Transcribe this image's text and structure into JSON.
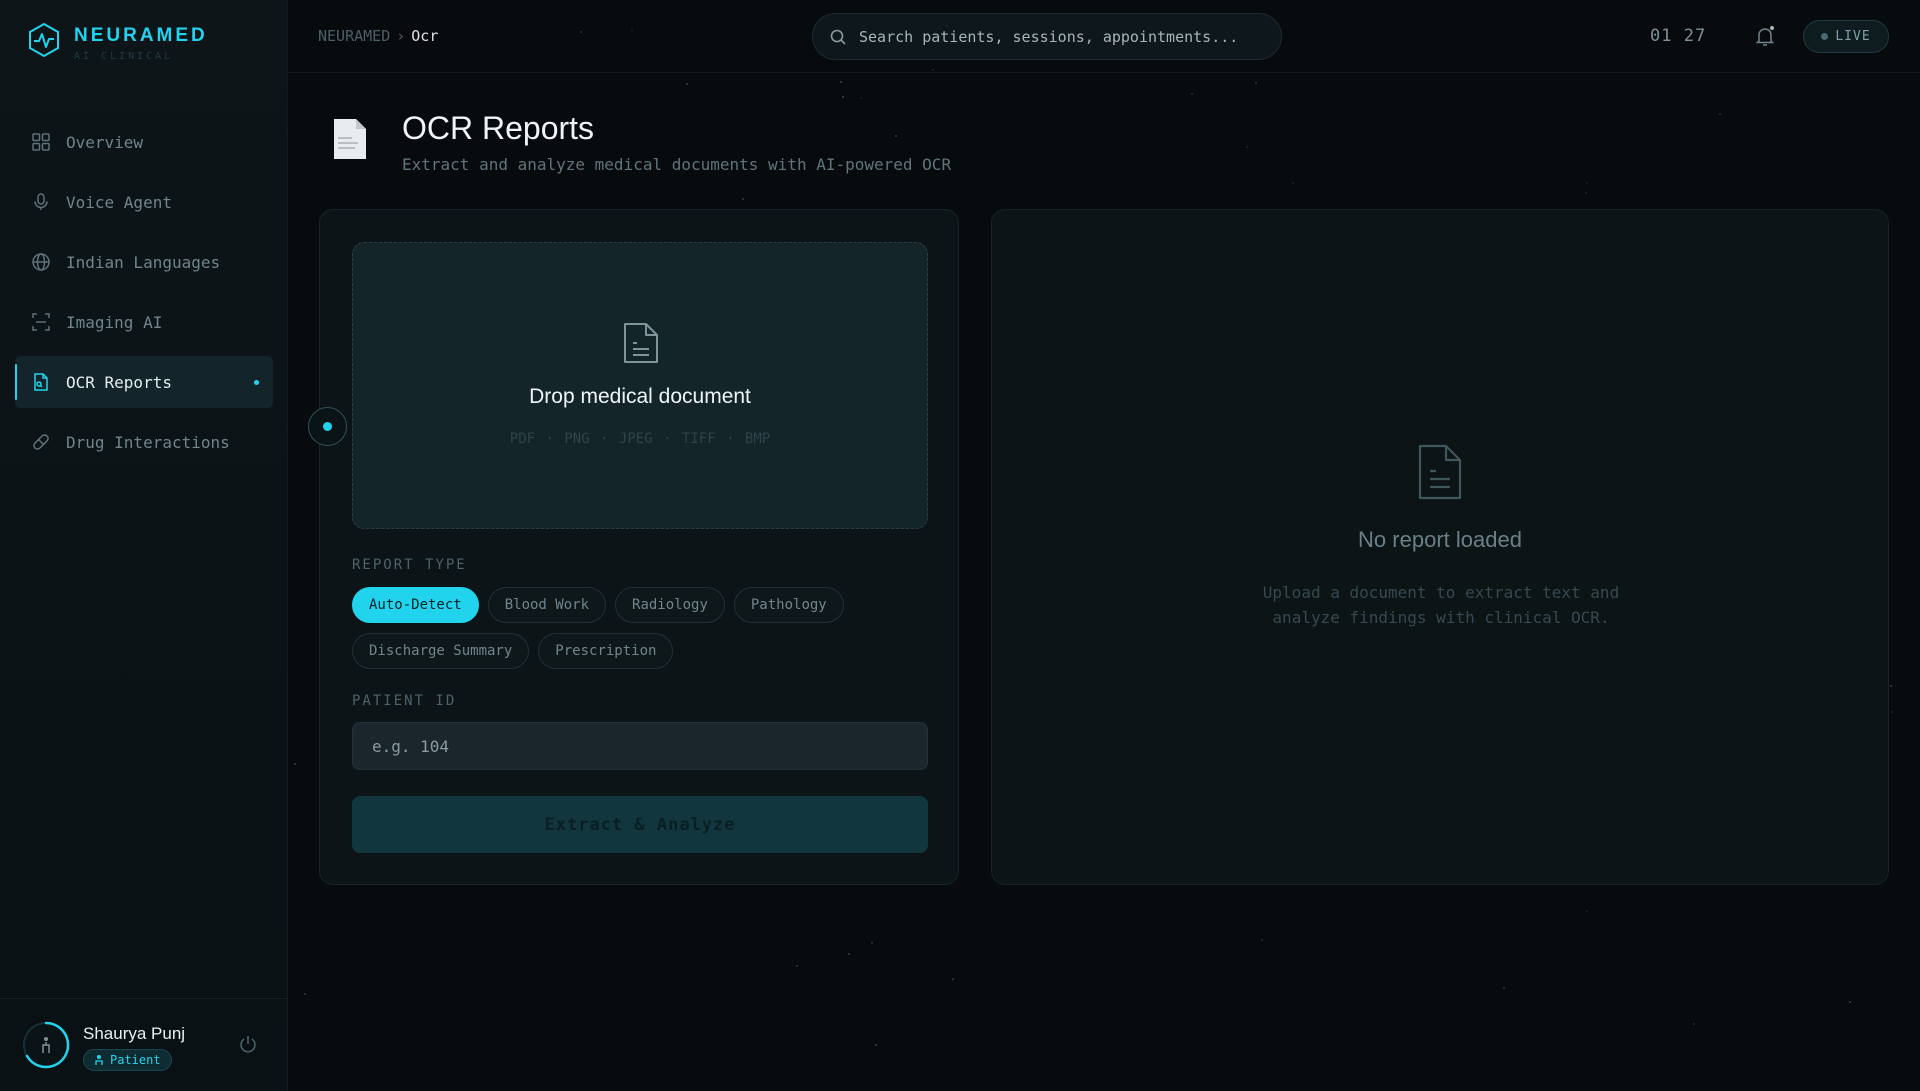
{
  "brand": {
    "name": "NEURAMED",
    "subtitle": "AI CLINICAL"
  },
  "nav": [
    {
      "label": "Overview",
      "icon": "grid-icon"
    },
    {
      "label": "Voice Agent",
      "icon": "microphone-icon"
    },
    {
      "label": "Indian Languages",
      "icon": "globe-icon"
    },
    {
      "label": "Imaging AI",
      "icon": "scan-icon"
    },
    {
      "label": "OCR Reports",
      "icon": "document-scan-icon",
      "active": true
    },
    {
      "label": "Drug Interactions",
      "icon": "pill-icon"
    }
  ],
  "user": {
    "name": "Shaurya Punj",
    "role": "Patient"
  },
  "breadcrumb": {
    "root": "NEURAMED",
    "separator": "›",
    "current": "Ocr"
  },
  "search": {
    "placeholder": "Search patients, sessions, appointments..."
  },
  "clock": "01 27",
  "live_label": "LIVE",
  "page": {
    "title": "OCR Reports",
    "subtitle": "Extract and analyze medical documents with AI-powered OCR"
  },
  "upload": {
    "title": "Drop medical document",
    "formats": "PDF · PNG · JPEG · TIFF · BMP"
  },
  "report_type": {
    "label": "REPORT TYPE",
    "options": [
      "Auto-Detect",
      "Blood Work",
      "Radiology",
      "Pathology",
      "Discharge Summary",
      "Prescription"
    ],
    "selected": "Auto-Detect"
  },
  "patient_id": {
    "label": "PATIENT ID",
    "placeholder": "e.g. 104",
    "value": ""
  },
  "extract_button": "Extract & Analyze",
  "empty_state": {
    "title": "No report loaded",
    "description": "Upload a document to extract text and analyze findings with clinical OCR."
  },
  "colors": {
    "accent": "#22d3ee",
    "background": "#070b0e",
    "panel": "#0c1417"
  }
}
